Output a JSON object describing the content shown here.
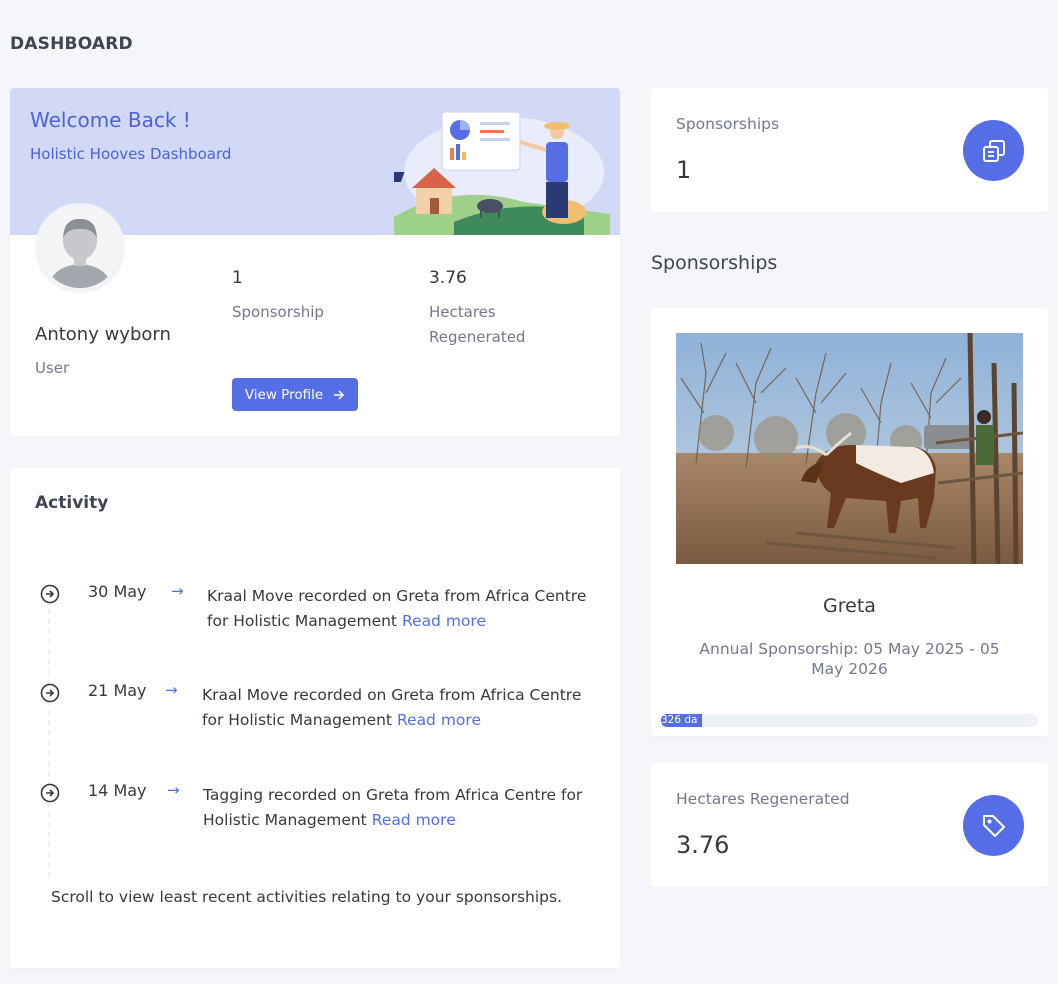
{
  "page": {
    "title": "DASHBOARD"
  },
  "welcome": {
    "title": "Welcome Back !",
    "subtitle": "Holistic Hooves Dashboard",
    "user_name": "Antony wyborn",
    "user_role": "User",
    "stats": [
      {
        "value": "1",
        "label": "Sponsorship"
      },
      {
        "value": "3.76",
        "label": "Hectares Regenerated"
      }
    ],
    "view_profile_label": "View Profile"
  },
  "activity": {
    "title": "Activity",
    "items": [
      {
        "date": "30 May",
        "text": "Kraal Move recorded on Greta from Africa Centre for Holistic Management",
        "link": "Read more"
      },
      {
        "date": "21 May",
        "text": "Kraal Move recorded on Greta from Africa Centre for Holistic Management",
        "link": "Read more"
      },
      {
        "date": "14 May",
        "text": "Tagging recorded on Greta from Africa Centre for Holistic Management",
        "link": "Read more"
      }
    ],
    "hint": "Scroll to view least recent activities relating to your sponsorships."
  },
  "sponsorships_stat": {
    "label": "Sponsorships",
    "value": "1",
    "icon": "copy-icon"
  },
  "sponsorships_section": {
    "title": "Sponsorships"
  },
  "sponsorship": {
    "animal_name": "Greta",
    "dates": "Annual Sponsorship: 05 May 2025 - 05 May 2026",
    "progress_text": "326 da",
    "progress_fraction": 0.11
  },
  "hectares_stat": {
    "label": "Hectares Regenerated",
    "value": "3.76",
    "icon": "tag-icon"
  },
  "colors": {
    "primary": "#556ee6",
    "banner": "#d2d9f7",
    "background": "#f5f6f9"
  }
}
